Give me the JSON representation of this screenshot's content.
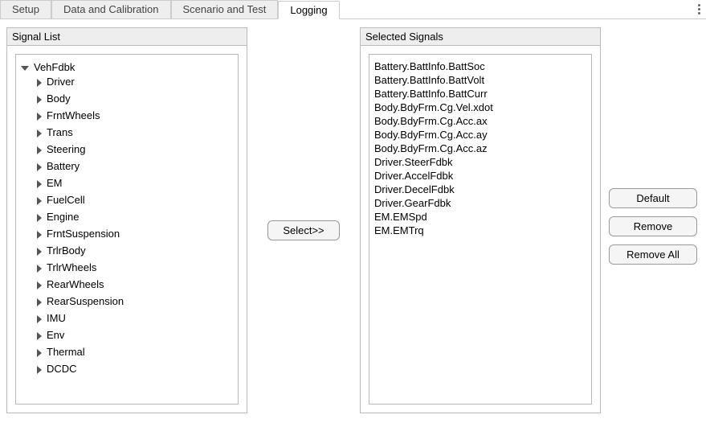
{
  "tabs": {
    "setup": "Setup",
    "data_calibration": "Data and Calibration",
    "scenario_test": "Scenario and Test",
    "logging": "Logging"
  },
  "active_tab": "logging",
  "signal_list": {
    "title": "Signal List",
    "root": {
      "label": "VehFdbk",
      "children": [
        "Driver",
        "Body",
        "FrntWheels",
        "Trans",
        "Steering",
        "Battery",
        "EM",
        "FuelCell",
        "Engine",
        "FrntSuspension",
        "TrlrBody",
        "TrlrWheels",
        "RearWheels",
        "RearSuspension",
        "IMU",
        "Env",
        "Thermal",
        "DCDC"
      ]
    }
  },
  "selected_signals": {
    "title": "Selected Signals",
    "items": [
      "Battery.BattInfo.BattSoc",
      "Battery.BattInfo.BattVolt",
      "Battery.BattInfo.BattCurr",
      "Body.BdyFrm.Cg.Vel.xdot",
      "Body.BdyFrm.Cg.Acc.ax",
      "Body.BdyFrm.Cg.Acc.ay",
      "Body.BdyFrm.Cg.Acc.az",
      "Driver.SteerFdbk",
      "Driver.AccelFdbk",
      "Driver.DecelFdbk",
      "Driver.GearFdbk",
      "EM.EMSpd",
      "EM.EMTrq"
    ]
  },
  "buttons": {
    "select": "Select>>",
    "default": "Default",
    "remove": "Remove",
    "remove_all": "Remove All"
  }
}
